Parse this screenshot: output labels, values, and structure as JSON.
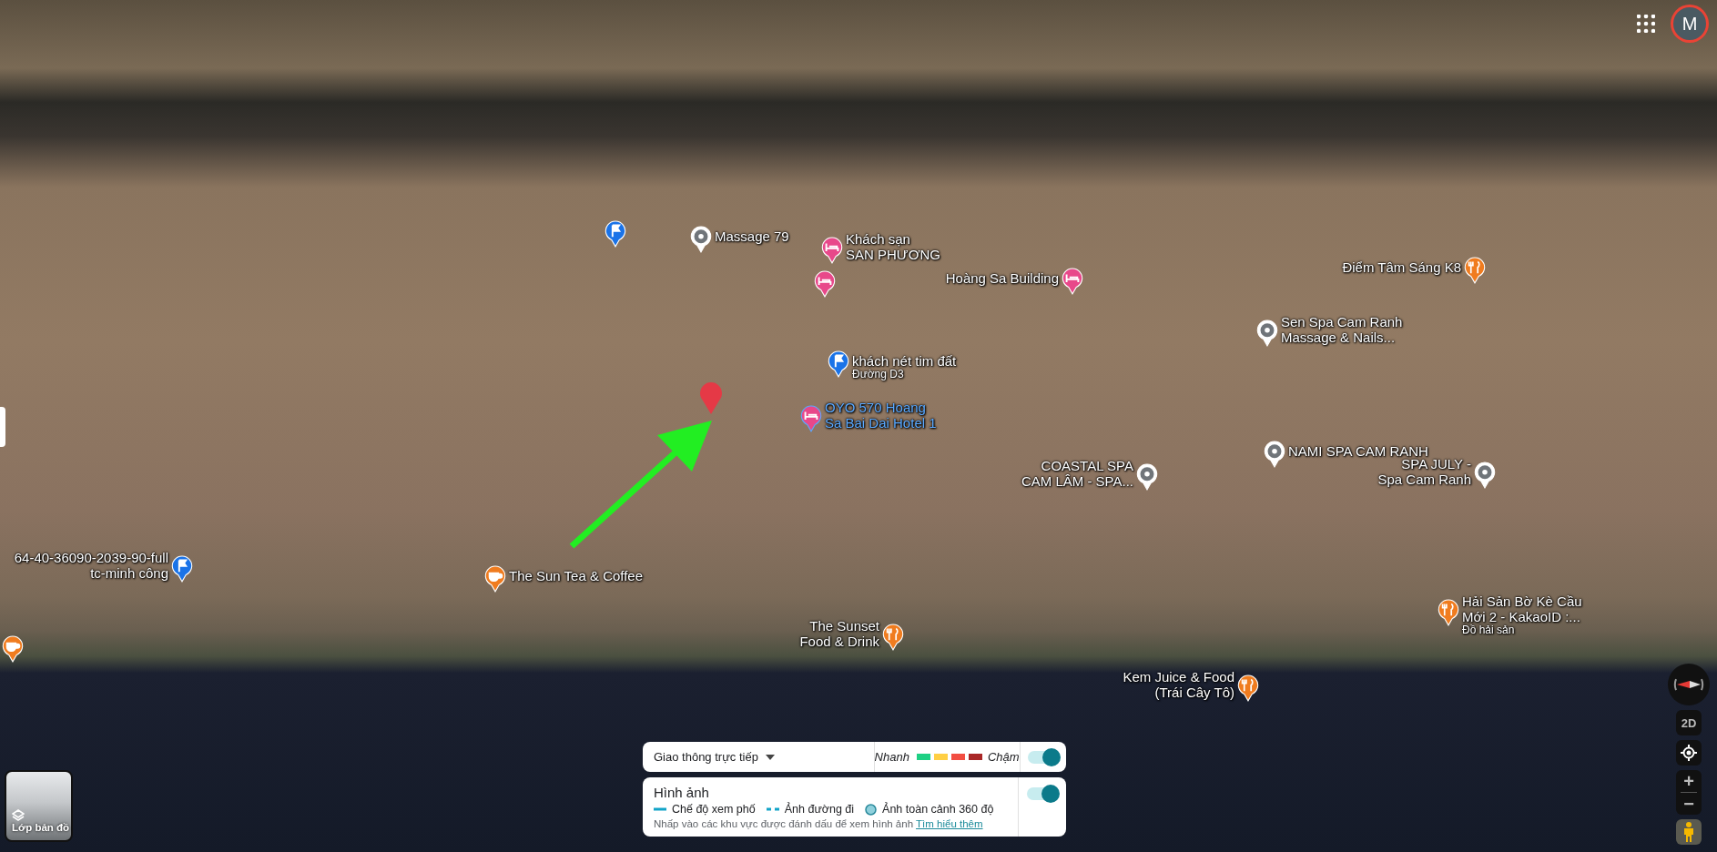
{
  "account": {
    "initial": "M"
  },
  "places": [
    {
      "kind": "flag",
      "highlighted": false
    },
    {
      "kind": "pin",
      "lines": [
        "Massage 79"
      ],
      "highlighted": false
    },
    {
      "kind": "hotel",
      "lines": [
        "Khách sạn",
        "SAN PHƯƠNG"
      ],
      "highlighted": false
    },
    {
      "kind": "hotel",
      "highlighted": false
    },
    {
      "kind": "hotel",
      "lines": [
        "Hoàng Sa Building"
      ],
      "highlighted": false
    },
    {
      "kind": "food",
      "lines": [
        "Điểm Tâm Sáng K8"
      ],
      "highlighted": false
    },
    {
      "kind": "pin",
      "lines": [
        "Sen Spa Cam Ranh",
        "Massage & Nails..."
      ],
      "highlighted": false
    },
    {
      "kind": "flag",
      "lines": [
        "khách nét tim đất"
      ],
      "subtitle": "Đường D3",
      "highlighted": false
    },
    {
      "kind": "hotel",
      "lines": [
        "OYO 570 Hoang",
        "Sa Bai Dai Hotel 1"
      ],
      "highlighted": true
    },
    {
      "kind": "pin",
      "lines": [
        "NAMI SPA CAM RANH"
      ],
      "highlighted": false
    },
    {
      "kind": "pin",
      "lines": [
        "COASTAL SPA",
        "CAM LÂM - SPA..."
      ],
      "highlighted": false
    },
    {
      "kind": "pin",
      "lines": [
        "SPA JULY -",
        "Spa Cam Ranh"
      ],
      "highlighted": false
    },
    {
      "kind": "flag",
      "lines": [
        "64-40-36090-2039-90-full",
        "tc-minh công"
      ],
      "highlighted": false
    },
    {
      "kind": "cafe",
      "lines": [
        "The Sun Tea & Coffee"
      ],
      "highlighted": false
    },
    {
      "kind": "food",
      "lines": [
        "The Sunset",
        "Food & Drink"
      ],
      "highlighted": false
    },
    {
      "kind": "food",
      "lines": [
        "Hải Sản Bờ Kè Cầu",
        "Mới 2 - KakaoID :..."
      ],
      "subtitle": "Đồ hải sản",
      "highlighted": false
    },
    {
      "kind": "food",
      "lines": [
        "Kem Juice & Food",
        "(Trái Cây Tô)"
      ],
      "highlighted": false
    },
    {
      "kind": "cafe",
      "highlighted": false
    }
  ],
  "layers_button": {
    "label": "Lớp bản đồ"
  },
  "traffic": {
    "label": "Giao thông trực tiếp",
    "fast": "Nhanh",
    "slow": "Chậm",
    "on": true,
    "legend": [
      {
        "color": "#1ed084"
      },
      {
        "color": "#ffcf44"
      },
      {
        "color": "#f24e42"
      },
      {
        "color": "#a92727"
      }
    ]
  },
  "imagery": {
    "title": "Hình ảnh",
    "on": true,
    "legend": [
      {
        "kind": "line",
        "label": "Chế độ xem phố"
      },
      {
        "kind": "dashed",
        "label": "Ảnh đường đi"
      },
      {
        "kind": "dot",
        "label": "Ảnh toàn cảnh 360 độ"
      }
    ],
    "hint": "Nhấp vào các khu vực được đánh dấu để xem hình ảnh",
    "link": "Tìm hiểu thêm"
  },
  "controls": {
    "view_mode": "2D",
    "zoom_in": "+",
    "zoom_out": "−"
  }
}
